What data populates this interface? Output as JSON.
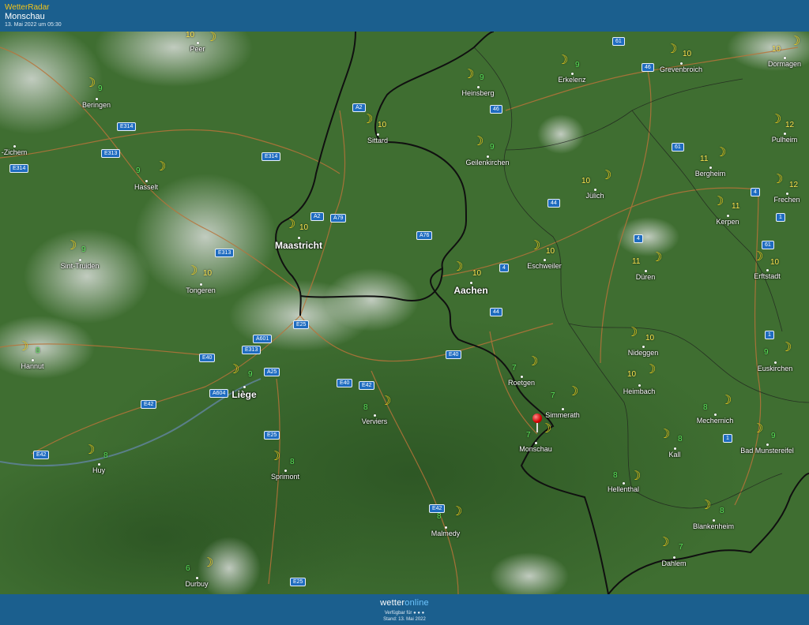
{
  "header": {
    "app_name": "WetterRadar",
    "location": "Monschau",
    "timestamp": "13. Mai 2022 um 05:30"
  },
  "footer": {
    "logo_text_1": "wetter",
    "logo_text_2": "online",
    "available_text": "Verfügbar für ● ● ●",
    "status_text": "Stand: 13. Mai 2022"
  },
  "colors": {
    "header_bg": "#1b5f8e",
    "land": "#3d6b2f",
    "moon": "#f5d21f",
    "temp_warm": "#ffe650",
    "temp_cool": "#59e659",
    "road_badge": "#1f6cc0",
    "pin": "#d10000"
  },
  "icons": {
    "weather": "moon-icon",
    "marker": "location-pin-icon"
  },
  "cities": [
    {
      "name": "Peer",
      "temp": "10",
      "warm": true
    },
    {
      "name": "Beringen",
      "temp": "9",
      "warm": false
    },
    {
      "name": "-Zichem",
      "temp": "",
      "warm": false
    },
    {
      "name": "Hasselt",
      "temp": "9",
      "warm": false
    },
    {
      "name": "Sint-Truiden",
      "temp": "9",
      "warm": false
    },
    {
      "name": "Tongeren",
      "temp": "10",
      "warm": true
    },
    {
      "name": "Hannut",
      "temp": "8",
      "warm": false
    },
    {
      "name": "Maastricht",
      "temp": "10",
      "warm": true
    },
    {
      "name": "Sittard",
      "temp": "10",
      "warm": true
    },
    {
      "name": "Heinsberg",
      "temp": "9",
      "warm": false
    },
    {
      "name": "Erkelenz",
      "temp": "9",
      "warm": false
    },
    {
      "name": "Grevenbroich",
      "temp": "10",
      "warm": true
    },
    {
      "name": "Dormagen",
      "temp": "10",
      "warm": true
    },
    {
      "name": "Geilenkirchen",
      "temp": "9",
      "warm": false
    },
    {
      "name": "Pulheim",
      "temp": "12",
      "warm": true
    },
    {
      "name": "Bergheim",
      "temp": "11",
      "warm": true
    },
    {
      "name": "Jülich",
      "temp": "10",
      "warm": true
    },
    {
      "name": "Frechen",
      "temp": "12",
      "warm": true
    },
    {
      "name": "Kerpen",
      "temp": "11",
      "warm": true
    },
    {
      "name": "Eschweiler",
      "temp": "10",
      "warm": true
    },
    {
      "name": "Düren",
      "temp": "11",
      "warm": true
    },
    {
      "name": "Erftstadt",
      "temp": "10",
      "warm": true
    },
    {
      "name": "Aachen",
      "temp": "10",
      "warm": true
    },
    {
      "name": "Liège",
      "temp": "9",
      "warm": false
    },
    {
      "name": "Huy",
      "temp": "8",
      "warm": false
    },
    {
      "name": "Sprimont",
      "temp": "8",
      "warm": false
    },
    {
      "name": "Verviers",
      "temp": "8",
      "warm": false
    },
    {
      "name": "Roetgen",
      "temp": "7",
      "warm": false
    },
    {
      "name": "Simmerath",
      "temp": "7",
      "warm": false
    },
    {
      "name": "Monschau",
      "temp": "7",
      "warm": false
    },
    {
      "name": "Nideggen",
      "temp": "10",
      "warm": true
    },
    {
      "name": "Heimbach",
      "temp": "10",
      "warm": true
    },
    {
      "name": "Euskirchen",
      "temp": "9",
      "warm": false
    },
    {
      "name": "Mechernich",
      "temp": "8",
      "warm": false
    },
    {
      "name": "Kall",
      "temp": "8",
      "warm": false
    },
    {
      "name": "Bad Munstereifel",
      "temp": "9",
      "warm": false
    },
    {
      "name": "Hellenthal",
      "temp": "8",
      "warm": false
    },
    {
      "name": "Blankenheim",
      "temp": "8",
      "warm": false
    },
    {
      "name": "Malmedy",
      "temp": "8",
      "warm": false
    },
    {
      "name": "Dahlem",
      "temp": "7",
      "warm": false
    },
    {
      "name": "Durbuy",
      "temp": "6",
      "warm": false
    }
  ],
  "roads": [
    "61",
    "46",
    "46",
    "A2",
    "E314",
    "E313",
    "E314",
    "E314",
    "A2",
    "A79",
    "A76",
    "E313",
    "44",
    "61",
    "4",
    "4",
    "1",
    "61",
    "4",
    "E25",
    "A601",
    "E40",
    "E313",
    "A25",
    "A604",
    "E40",
    "E42",
    "E42",
    "E40",
    "E25",
    "44",
    "1",
    "1",
    "E42",
    "E42",
    "E25"
  ]
}
